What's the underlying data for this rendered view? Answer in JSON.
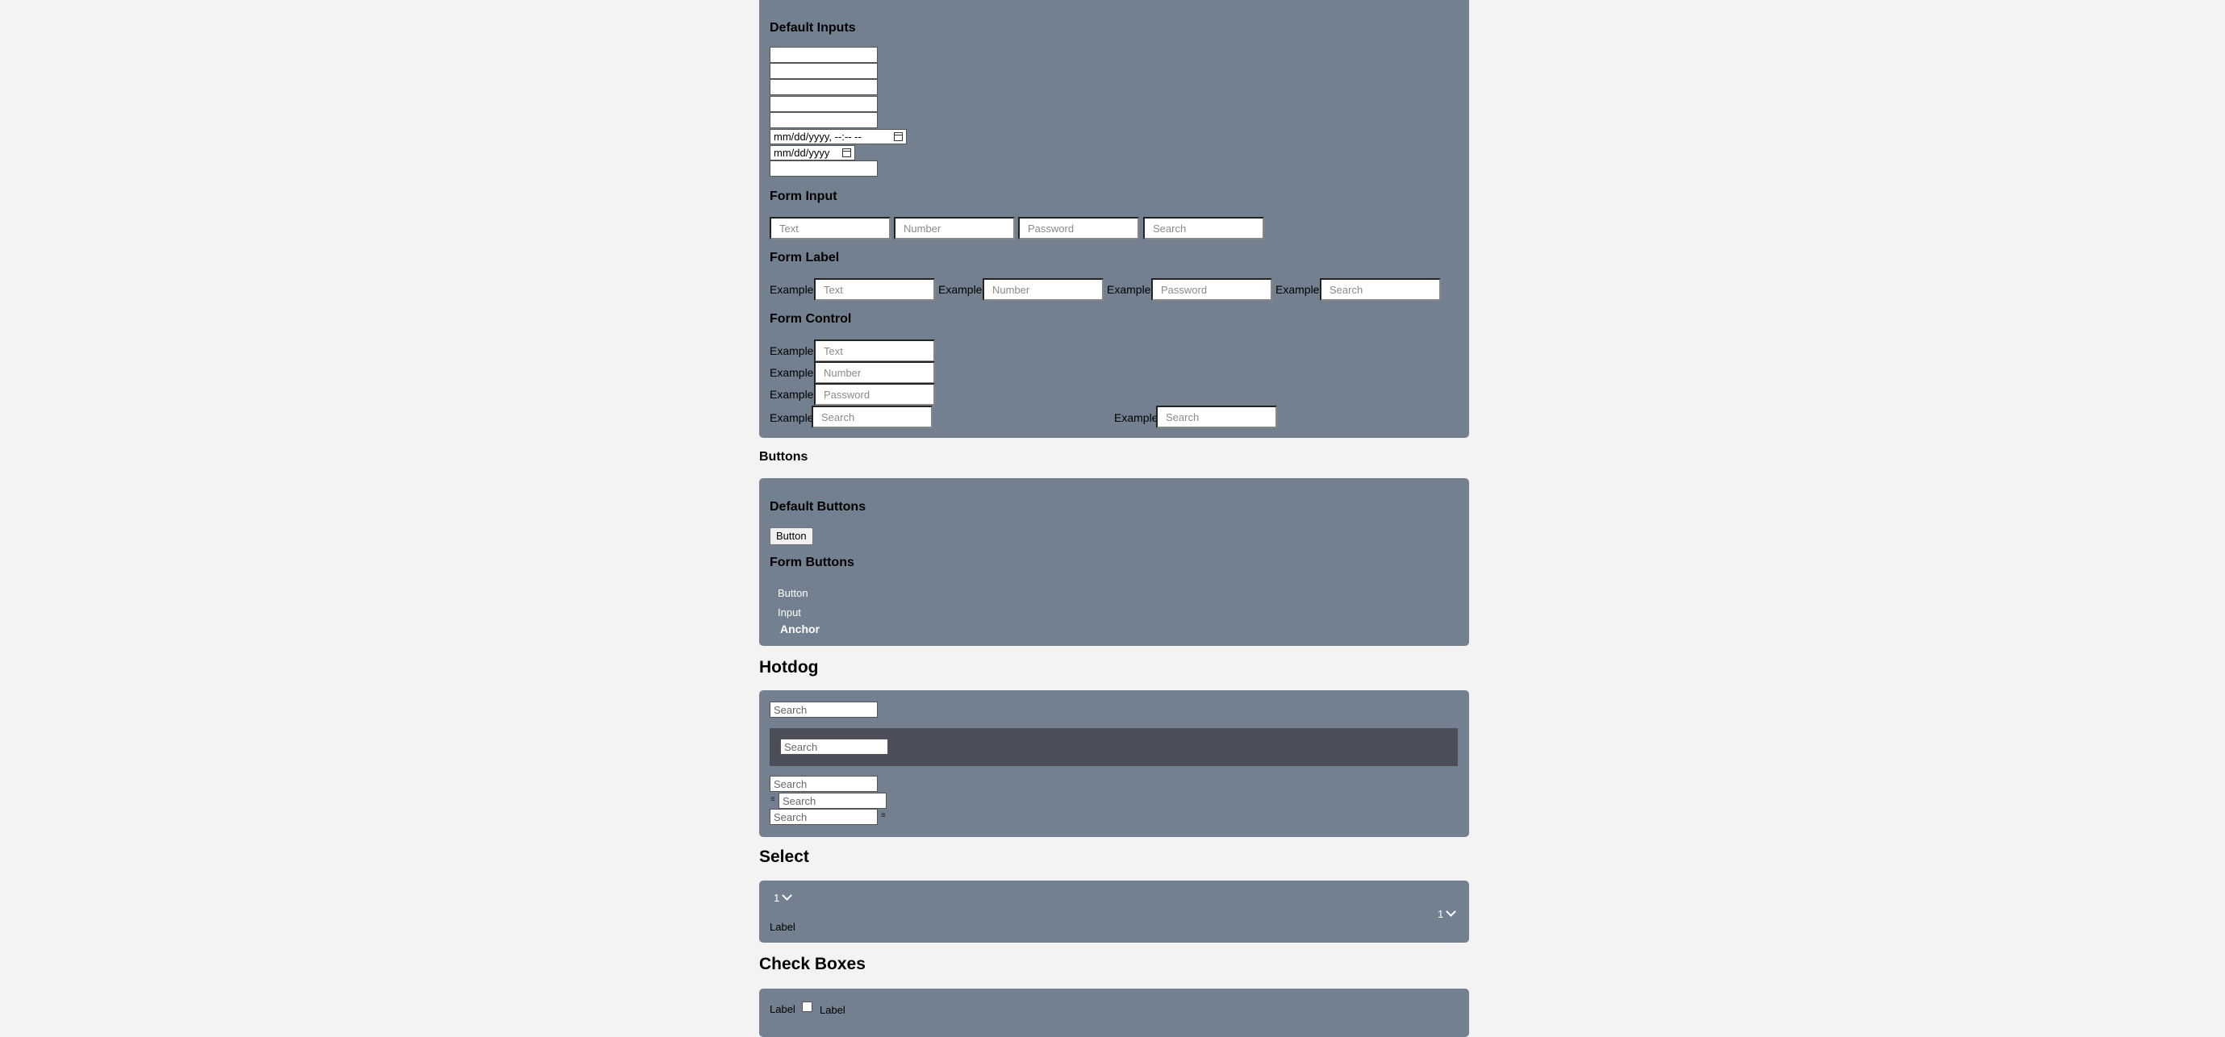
{
  "inputs_section": {
    "default_inputs_heading": "Default Inputs",
    "datetime_value": "mm/dd/yyyy, --:-- --",
    "date_value": "mm/dd/yyyy",
    "form_input_heading": "Form Input",
    "form_input_placeholders": [
      "Text",
      "Number",
      "Password",
      "Search"
    ],
    "form_label_heading": "Form Label",
    "form_label_labels": [
      "Example",
      "Example",
      "Example",
      "Example"
    ],
    "form_label_placeholders": [
      "Text",
      "Number",
      "Password",
      "Search"
    ],
    "form_control_heading": "Form Control",
    "form_control_labels": [
      "Example",
      "Example",
      "Example",
      "Example",
      "Example"
    ],
    "form_control_placeholders": [
      "Text",
      "Number",
      "Password",
      "Search",
      "Search"
    ]
  },
  "buttons_section": {
    "title": "Buttons",
    "default_buttons_heading": "Default Buttons",
    "default_button_label": "Button",
    "form_buttons_heading": "Form Buttons",
    "form_button_label": "Button",
    "form_input_button_label": "Input",
    "form_anchor_label": "Anchor"
  },
  "hotdog_section": {
    "title": "Hotdog",
    "search_placeholder": "Search",
    "dark_search_placeholder": "Search",
    "stack_placeholders": [
      "Search",
      "Search",
      "Search"
    ]
  },
  "select_section": {
    "title": "Select",
    "select_value_1": "1",
    "select_value_2": "1",
    "label": "Label"
  },
  "checkbox_section": {
    "title": "Check Boxes",
    "label_before": "Label",
    "label_after": "Label"
  }
}
